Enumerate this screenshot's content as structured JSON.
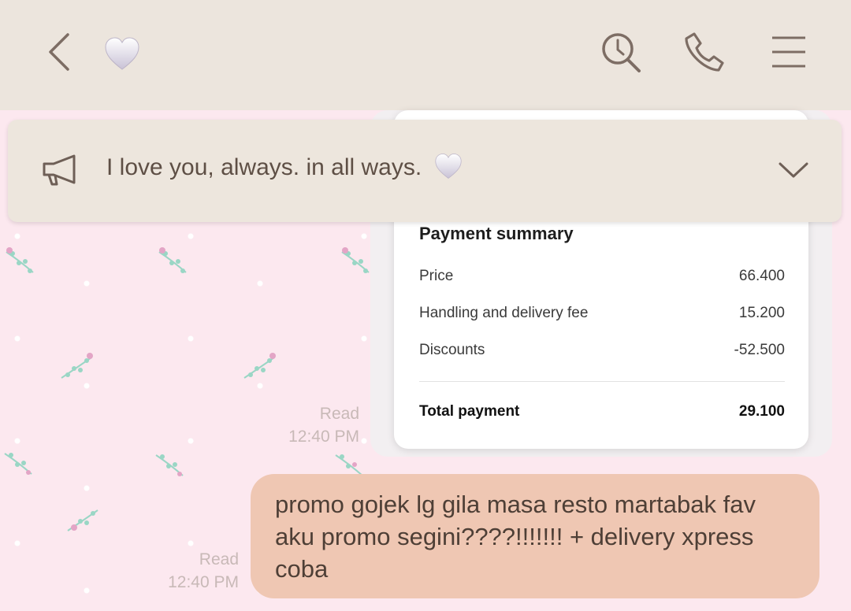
{
  "header": {
    "back_icon": "chevron-left-icon",
    "chat_name_emoji": "white-heart-emoji",
    "actions": [
      "search-icon",
      "phone-icon",
      "menu-icon"
    ]
  },
  "announcement": {
    "icon": "megaphone-icon",
    "text": "I love you, always. in all ways.",
    "expand_icon": "chevron-down-icon"
  },
  "receipt": {
    "title": "Payment summary",
    "rows": [
      {
        "label": "Price",
        "value": "66.400"
      },
      {
        "label": "Handling and delivery fee",
        "value": "15.200"
      },
      {
        "label": "Discounts",
        "value": "-52.500"
      }
    ],
    "total_label": "Total payment",
    "total_value": "29.100"
  },
  "messages": [
    {
      "status": "Read",
      "time": "12:40 PM"
    },
    {
      "status": "Read",
      "time": "12:40 PM",
      "text": "promo gojek lg gila masa resto martabak fav aku promo segini????!!!!!!! + delivery xpress coba"
    }
  ],
  "colors": {
    "topbar": "#ece5dd",
    "chat_background": "#fce8ef",
    "bubble": "#efc7b3",
    "icon": "#7d6d64"
  }
}
